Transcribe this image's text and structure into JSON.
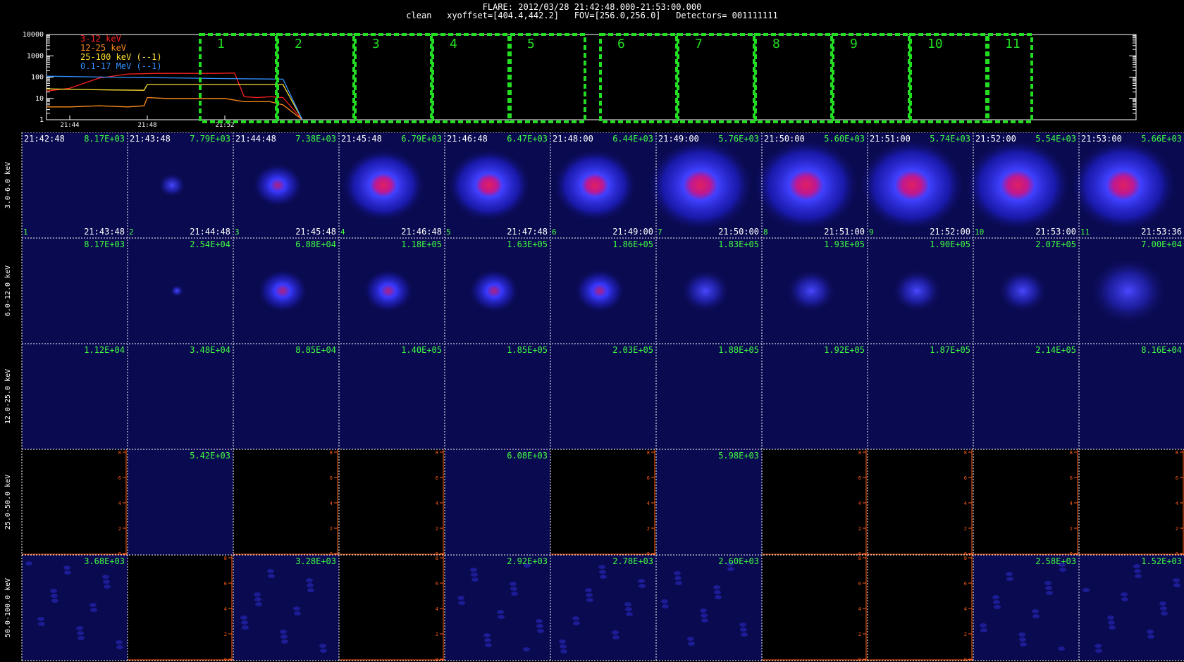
{
  "header": {
    "line1": "FLARE: 2012/03/28 21:42:48.000-21:53:00.000",
    "line2": "clean   xyoffset=[404.4,442.2]   FOV=[256.0,256.0]   Detectors= 001111111"
  },
  "chart_data": [
    {
      "type": "line",
      "yscale": "log",
      "ylim": [
        1,
        10000
      ],
      "ytick_labels": [
        "10000",
        "1000",
        "100",
        "10",
        "1"
      ],
      "xtick_labels": [
        "21:44",
        "21:48",
        "21:52"
      ],
      "legend_placement": "top-left",
      "series": [
        {
          "name": "3-12 keV",
          "color": "#ff2020",
          "x": [
            "21:42:48",
            "21:44:00",
            "21:45:30",
            "21:47:00",
            "21:48:30",
            "21:50:00",
            "21:51:30",
            "21:52:30",
            "21:53:00",
            "21:53:40",
            "21:54:20",
            "21:55:00",
            "21:56:00"
          ],
          "values": [
            22,
            30,
            90,
            140,
            150,
            150,
            150,
            155,
            12,
            11,
            12,
            11,
            1
          ]
        },
        {
          "name": "12-25 keV",
          "color": "#ff8c1a",
          "x": [
            "21:42:48",
            "21:44:00",
            "21:45:30",
            "21:47:00",
            "21:47:50",
            "21:48:00",
            "21:49:00",
            "21:50:30",
            "21:52:00",
            "21:53:00",
            "21:54:20",
            "21:55:00",
            "21:56:00"
          ],
          "values": [
            4,
            4,
            4.5,
            4,
            4.5,
            11,
            10,
            10,
            10,
            7,
            7,
            5,
            1
          ]
        },
        {
          "name": "25-100 keV (--1)",
          "color": "#ffe030",
          "x": [
            "21:42:48",
            "21:46:00",
            "21:47:50",
            "21:48:00",
            "21:52:00",
            "21:55:00",
            "21:56:00"
          ],
          "values": [
            28,
            25,
            24,
            45,
            45,
            45,
            1
          ]
        },
        {
          "name": "0.1-17 MeV (--1)",
          "color": "#3090ff",
          "x": [
            "21:42:48",
            "21:46:00",
            "21:48:00",
            "21:52:00",
            "21:55:00",
            "21:56:00"
          ],
          "values": [
            110,
            100,
            95,
            85,
            80,
            1
          ]
        }
      ],
      "intervals": [
        "1",
        "2",
        "3",
        "4",
        "5",
        "6",
        "7",
        "8",
        "9",
        "10",
        "11"
      ]
    },
    {
      "type": "heatmap",
      "row_labels": [
        "3.0-6.0 keV",
        "6.0-12.0 keV",
        "12.0-25.0 keV",
        "25.0-50.0 keV",
        "50.0-100.0 keV"
      ],
      "start_times": [
        "21:42:48",
        "21:43:48",
        "21:44:48",
        "21:45:48",
        "21:46:48",
        "21:48:00",
        "21:49:00",
        "21:50:00",
        "21:51:00",
        "21:52:00",
        "21:53:00"
      ],
      "end_times": [
        "21:43:48",
        "21:44:48",
        "21:45:48",
        "21:46:48",
        "21:47:48",
        "21:49:00",
        "21:50:00",
        "21:51:00",
        "21:52:00",
        "21:53:00",
        "21:53:36"
      ],
      "interval_numbers": [
        "1",
        "2",
        "3",
        "4",
        "5",
        "6",
        "7",
        "8",
        "9",
        "10",
        "11"
      ],
      "max_values": [
        [
          "8.17E+03",
          "7.79E+03",
          "7.38E+03",
          "6.79E+03",
          "6.47E+03",
          "6.44E+03",
          "5.76E+03",
          "5.60E+03",
          "5.74E+03",
          "5.54E+03",
          "5.66E+03"
        ],
        [
          "8.17E+03",
          "2.54E+04",
          "6.88E+04",
          "1.18E+05",
          "1.63E+05",
          "1.86E+05",
          "1.83E+05",
          "1.93E+05",
          "1.90E+05",
          "2.07E+05",
          "7.00E+04"
        ],
        [
          "1.12E+04",
          "3.48E+04",
          "8.85E+04",
          "1.40E+05",
          "1.85E+05",
          "2.03E+05",
          "1.88E+05",
          "1.92E+05",
          "1.87E+05",
          "2.14E+05",
          "8.16E+04"
        ],
        [
          "",
          "5.42E+03",
          "",
          "",
          "6.08E+03",
          "",
          "5.98E+03",
          "",
          "",
          "",
          ""
        ],
        [
          "3.68E+03",
          "",
          "3.28E+03",
          "",
          "2.92E+03",
          "2.78E+03",
          "2.60E+03",
          "",
          "",
          "2.58E+03",
          "1.52E+03"
        ]
      ],
      "empty_axis_ticks": [
        "0",
        "2",
        "4",
        "6",
        "8"
      ]
    }
  ],
  "colors": {
    "interval_box": "#22dd22",
    "max_label": "#40ff40",
    "empty_axis": "#ff5a1a",
    "sep": "#ffffff"
  }
}
